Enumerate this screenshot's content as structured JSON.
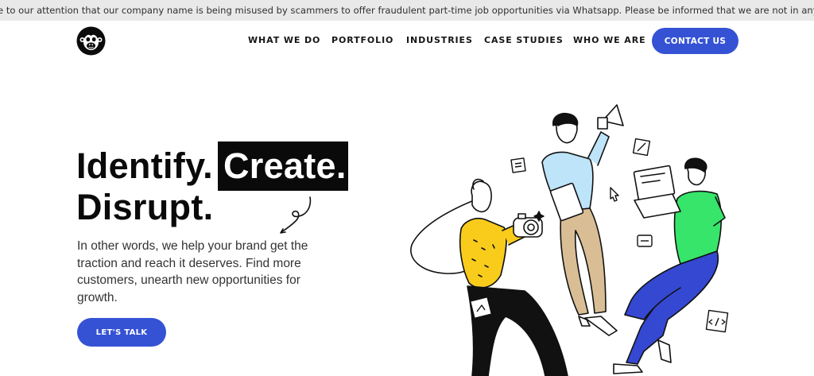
{
  "announcement": {
    "text": "e to our attention that our company name is being misused by scammers to offer fraudulent part-time job opportunities via Whatsapp. Please be informed that we are not in anyway associated with these people no"
  },
  "header": {
    "logo_icon": "monkey-icon",
    "nav": [
      {
        "label": "WHAT WE DO"
      },
      {
        "label": "PORTFOLIO"
      },
      {
        "label": "INDUSTRIES"
      },
      {
        "label": "CASE STUDIES"
      },
      {
        "label": "WHO WE ARE"
      }
    ],
    "contact_label": "CONTACT US"
  },
  "hero": {
    "headline_part1": "Identify.",
    "headline_highlight": "Create.",
    "headline_part2": "Disrupt.",
    "description": "In other words, we help your brand get the traction and reach it deserves. Find more customers, unearth new opportunities for growth.",
    "cta_label": "LET'S TALK"
  },
  "colors": {
    "accent": "#3552d4",
    "ticker_bg": "#e9e9ea",
    "figure_yellow": "#f9cc1c",
    "figure_lightblue": "#bde4f8",
    "figure_green": "#37e56a",
    "figure_blue": "#3548d2",
    "figure_tan": "#d9be95"
  }
}
